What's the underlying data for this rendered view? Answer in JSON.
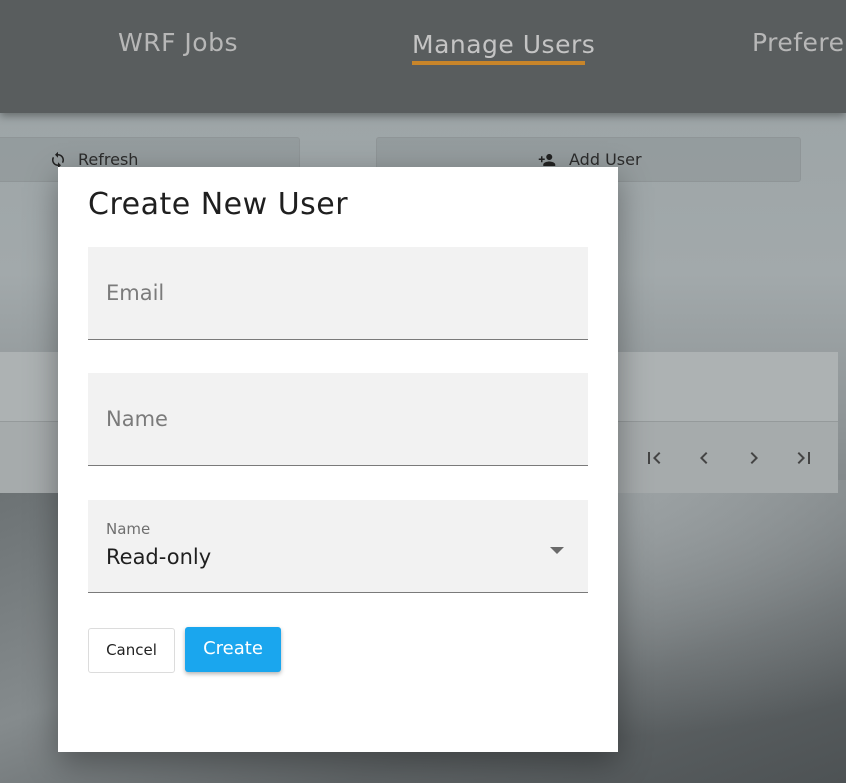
{
  "nav": {
    "tabs": [
      {
        "label": "WRF Jobs"
      },
      {
        "label": "Manage Users",
        "active": true
      },
      {
        "label": "Preferen"
      }
    ]
  },
  "toolbar": {
    "refresh_label": "Refresh",
    "add_user_label": "Add User"
  },
  "dialog": {
    "title": "Create New User",
    "email_placeholder": "Email",
    "name_placeholder": "Name",
    "role_label": "Name",
    "role_value": "Read-only",
    "cancel_label": "Cancel",
    "create_label": "Create"
  },
  "colors": {
    "nav_active_underline": "#c8852a",
    "primary_button": "#1aa6ee"
  }
}
